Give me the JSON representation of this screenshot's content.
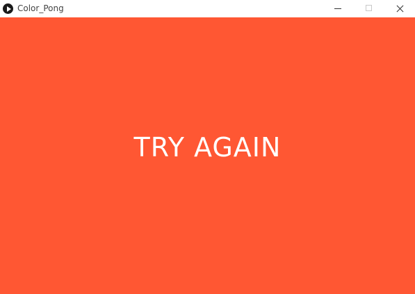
{
  "window": {
    "title": "Color_Pong",
    "controls": {
      "minimize": "minimize-icon",
      "maximize": "maximize-icon",
      "close": "close-icon"
    }
  },
  "game": {
    "background_color": "#ff5733",
    "message": "TRY AGAIN",
    "message_color": "#ffffff"
  }
}
